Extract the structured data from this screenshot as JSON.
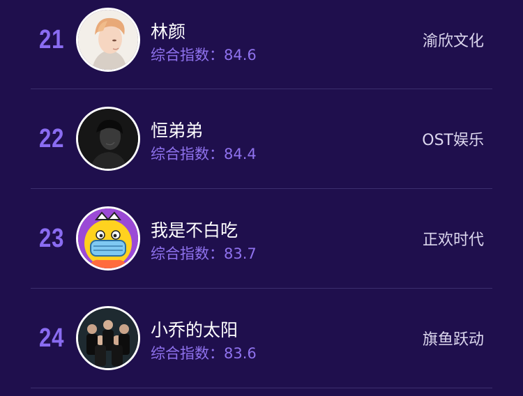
{
  "rows": [
    {
      "rank": "21",
      "name": "林颜",
      "score": "综合指数：84.6",
      "company": "渝欣文化",
      "avatar_icon": "cartoon-portrait-blond"
    },
    {
      "rank": "22",
      "name": "恒弟弟",
      "score": "综合指数：84.4",
      "company": "OST娱乐",
      "avatar_icon": "dark-portrait"
    },
    {
      "rank": "23",
      "name": "我是不白吃",
      "score": "综合指数：83.7",
      "company": "正欢时代",
      "avatar_icon": "yellow-cartoon-mask"
    },
    {
      "rank": "24",
      "name": "小乔的太阳",
      "score": "综合指数：83.6",
      "company": "旗鱼跃动",
      "avatar_icon": "group-photo"
    }
  ],
  "colors": {
    "background": "#1f0f4d",
    "rank": "#8a6cf2",
    "score": "#8f72ee",
    "divider": "#3c2f6e"
  }
}
